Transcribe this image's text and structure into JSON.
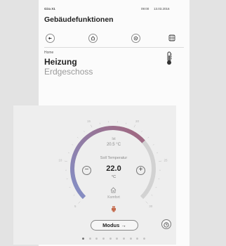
{
  "status_bar": {
    "device": "Gira X1",
    "time": "09:00",
    "date": "13.03.2016"
  },
  "page_title": "Gebäudefunktionen",
  "toolbar": {
    "icons": [
      "back-arrow-icon",
      "home-icon",
      "gear-icon",
      "grid-icon"
    ]
  },
  "room": {
    "breadcrumb": "Home",
    "name": "Heizung",
    "floor": "Erdgeschoss",
    "icon": "thermometer-icon"
  },
  "thermostat": {
    "ist_label": "Ist",
    "ist_value": "20.5 °C",
    "soll_label": "Soll Temperatur",
    "soll_value": "22.0",
    "unit": "°C",
    "mode_label": "Komfort",
    "scale_min": 5,
    "scale_max": 30,
    "current": 20.5,
    "setpoint": 22.0,
    "scale_labels": [
      "5",
      "10",
      "15",
      "20",
      "25",
      "30"
    ],
    "arc_colors": {
      "cold": "#8390c8",
      "warm": "#a2667d",
      "track": "#d2d2d2"
    }
  },
  "controls": {
    "minus": "−",
    "plus": "+",
    "mode_button": "Modus",
    "mode_arrow": "→"
  },
  "pager": {
    "count": 10,
    "active": 0
  }
}
